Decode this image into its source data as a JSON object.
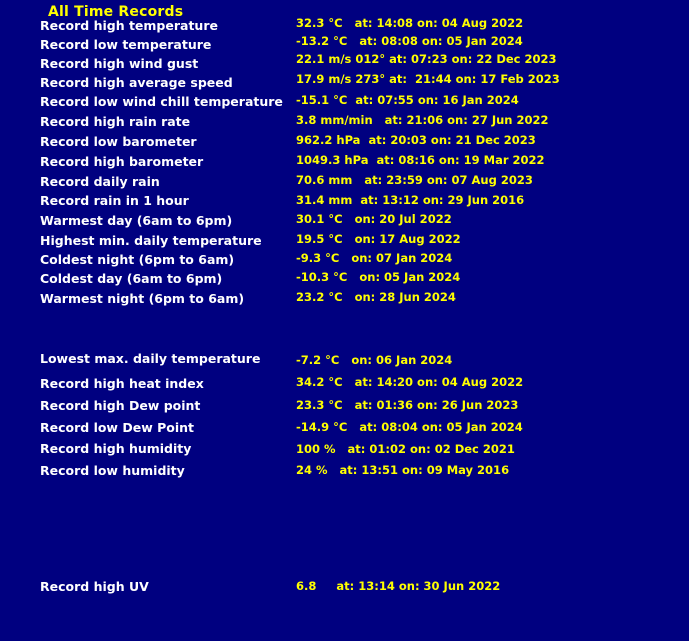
{
  "title": "All Time Records",
  "colors": {
    "background": "#000080",
    "label": "#ffffff",
    "value": "#ffff00"
  },
  "records": [
    {
      "label": "Record high temperature",
      "value": "32.3 °C   at: 14:08 on: 04 Aug 2022"
    },
    {
      "label": "Record low temperature",
      "value": "-13.2 °C   at: 08:08 on: 05 Jan 2024"
    },
    {
      "label": "Record high wind gust",
      "value": "22.1 m/s 012° at: 07:23 on: 22 Dec 2023"
    },
    {
      "label": "Record high average speed",
      "value": "17.9 m/s 273° at:  21:44 on: 17 Feb 2023"
    },
    {
      "label": "Record low wind chill temperature",
      "value": "-15.1 °C  at: 07:55 on: 16 Jan 2024"
    },
    {
      "label": "Record high rain rate",
      "value": "3.8 mm/min   at: 21:06 on: 27 Jun 2022"
    },
    {
      "label": "Record low barometer",
      "value": "962.2 hPa  at: 20:03 on: 21 Dec 2023"
    },
    {
      "label": "Record high barometer",
      "value": "1049.3 hPa  at: 08:16 on: 19 Mar 2022"
    },
    {
      "label": "Record daily rain",
      "value": "70.6 mm   at: 23:59 on: 07 Aug 2023"
    },
    {
      "label": "Record rain in 1 hour",
      "value": "31.4 mm  at: 13:12 on: 29 Jun 2016"
    },
    {
      "label": "Warmest day (6am to 6pm)",
      "value": "30.1 °C   on: 20 Jul 2022"
    },
    {
      "label": "Highest min. daily temperature",
      "value": "19.5 °C   on: 17 Aug 2022"
    },
    {
      "label": "Coldest night (6pm to 6am)",
      "value": "-9.3 °C   on: 07 Jan 2024"
    },
    {
      "label": "Coldest day (6am to 6pm)",
      "value": "-10.3 °C   on: 05 Jan 2024"
    },
    {
      "label": "Warmest night (6pm to 6am)",
      "value": "23.2 °C   on: 28 Jun 2024"
    },
    {
      "label": "Lowest max. daily temperature",
      "value": "-7.2 °C   on: 06 Jan 2024"
    },
    {
      "label": "Record high heat index",
      "value": "34.2 °C   at: 14:20 on: 04 Aug 2022"
    },
    {
      "label": "Record high Dew point",
      "value": "23.3 °C   at: 01:36 on: 26 Jun 2023"
    },
    {
      "label": "Record low Dew Point",
      "value": "-14.9 °C   at: 08:04 on: 05 Jan 2024"
    },
    {
      "label": "Record high humidity",
      "value": "100 %   at: 01:02 on: 02 Dec 2021"
    },
    {
      "label": "Record low humidity",
      "value": "24 %   at: 13:51 on: 09 May 2016"
    },
    {
      "label": "Record high UV",
      "value": "6.8     at: 13:14 on: 30 Jun 2022"
    }
  ]
}
